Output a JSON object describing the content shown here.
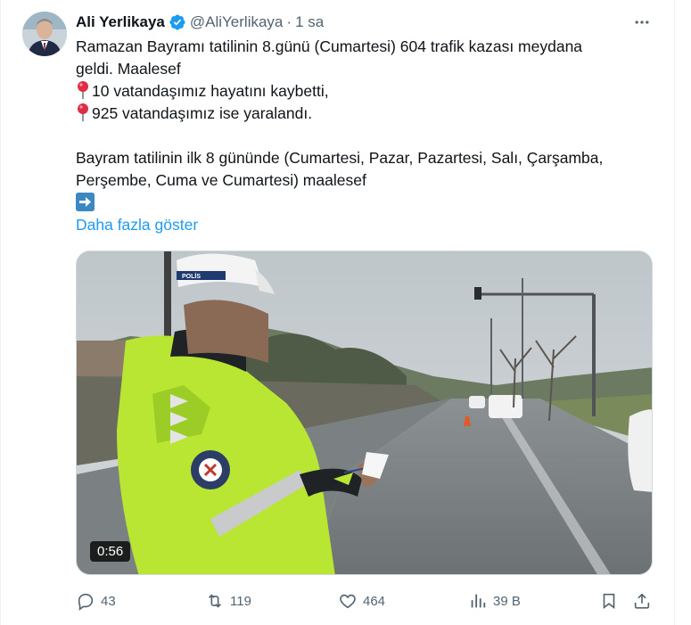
{
  "author": {
    "display_name": "Ali Yerlikaya",
    "handle": "@AliYerlikaya",
    "separator": "·",
    "time": "1 sa"
  },
  "icons": {
    "verified": "verified-badge-icon",
    "more": "more-icon",
    "pin": "round-pushpin-icon",
    "arrow": "right-arrow-icon"
  },
  "tweet": {
    "line1": "Ramazan Bayramı tatilinin 8.günü (Cumartesi) 604 trafik kazası meydana",
    "line2": "geldi. Maalesef",
    "line3": "10 vatandaşımız hayatını kaybetti,",
    "line4": "925 vatandaşımız ise yaralandı.",
    "line5": "Bayram tatilinin ilk 8 gününde (Cumartesi, Pazar, Pazartesi, Salı, Çarşamba,",
    "line6": "Perşembe, Cuma ve Cumartesi) maalesef",
    "show_more": "Daha fazla göster"
  },
  "media": {
    "duration": "0:56",
    "badge_text": "POLİS"
  },
  "actions": {
    "replies": "43",
    "reposts": "119",
    "likes": "464",
    "views": "39 B"
  },
  "colors": {
    "accent": "#1d9bf0",
    "verified": "#1d9bf0",
    "text": "#0f1419",
    "muted": "#536471"
  }
}
